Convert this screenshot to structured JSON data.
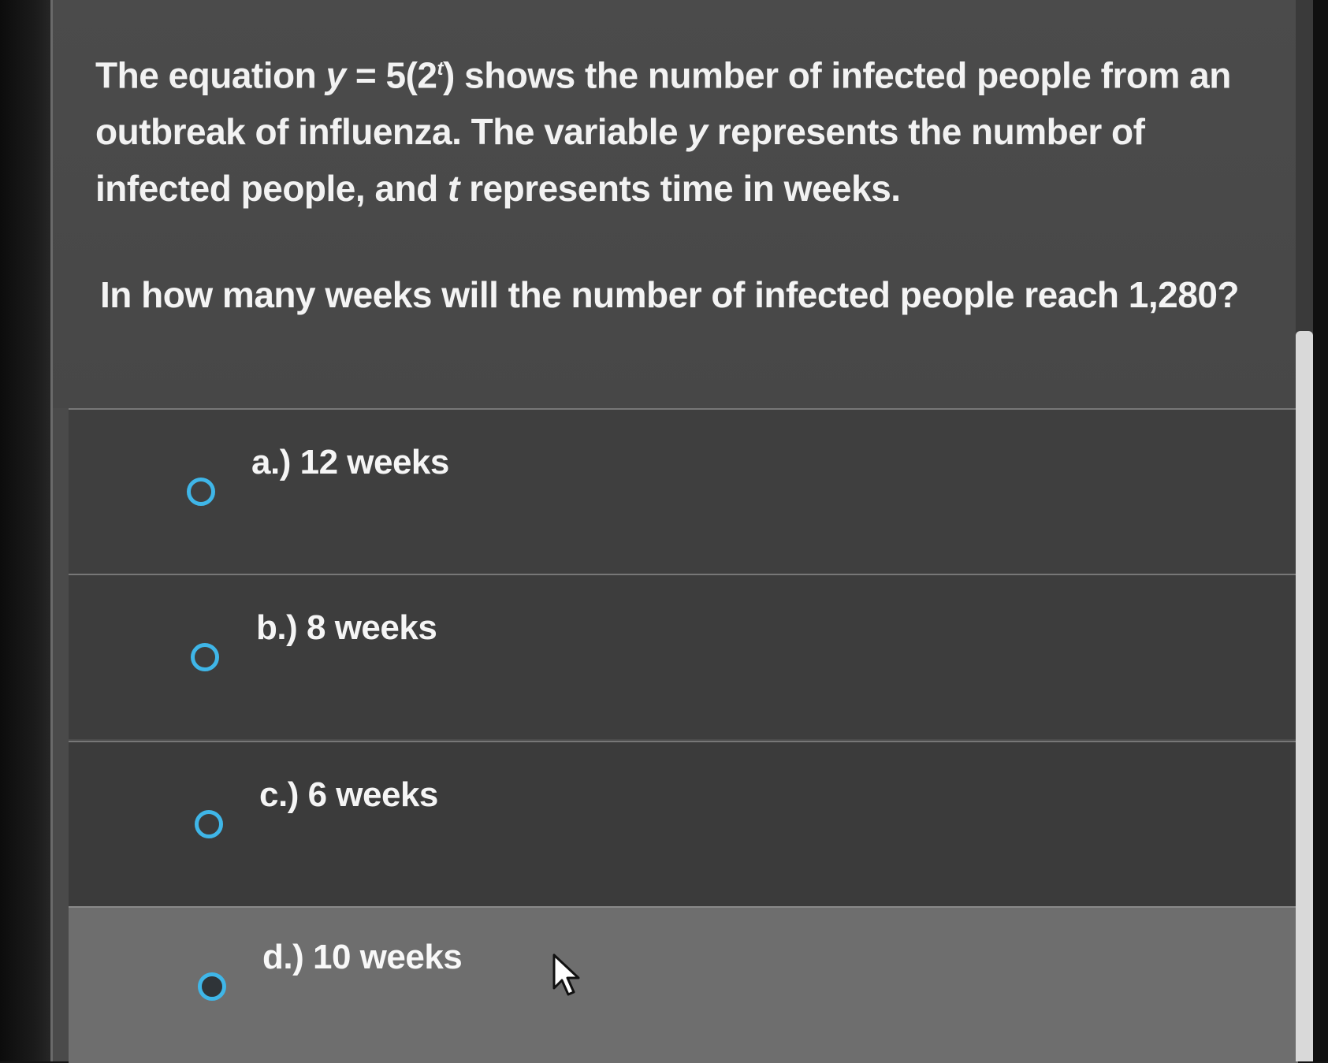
{
  "question": {
    "prefix": "The equation ",
    "eq_y": "y",
    "eq_middle": " = 5(2",
    "eq_exponent": "t",
    "eq_close": ")",
    "rest_line1": " shows the number of infected people from an outbreak of influenza. The variable ",
    "var_y": "y",
    "rest_line2": " represents the number of infected people, and ",
    "var_t": "t",
    "rest_line3": " represents time in weeks.",
    "ask": "In how many weeks will the number of infected people reach 1,280?"
  },
  "options": [
    {
      "letter": "a.)",
      "text": "12 weeks"
    },
    {
      "letter": "b.)",
      "text": "8 weeks"
    },
    {
      "letter": "c.)",
      "text": "6 weeks"
    },
    {
      "letter": "d.)",
      "text": "10 weeks"
    }
  ],
  "icons": {
    "radio": "radio-button-icon",
    "cursor": "mouse-pointer-icon"
  },
  "colors": {
    "radio_accent": "#3fb6e8",
    "hover_row": "#6e6e6e",
    "text": "#f2f2f2"
  }
}
